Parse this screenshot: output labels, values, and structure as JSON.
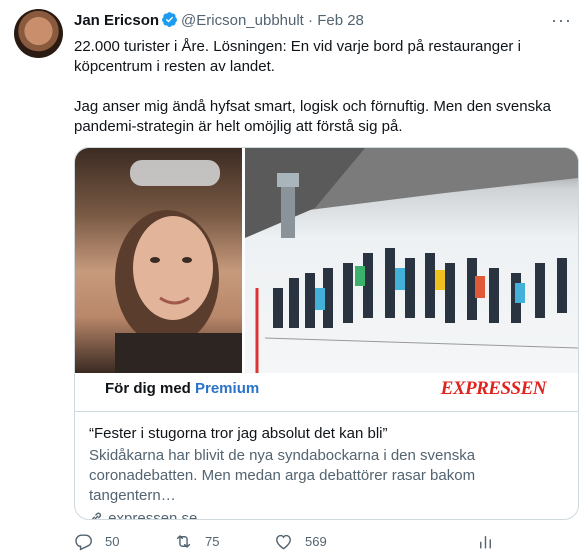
{
  "tweet": {
    "author_name": "Jan Ericson",
    "handle": "@Ericson_ubbhult",
    "separator": "·",
    "date": "Feb 28",
    "paragraphs": [
      "22.000 turister i Åre. Lösningen: En vid varje bord på restauranger i köpcentrum i resten av landet.",
      "Jag anser mig ändå hyfsat smart, logisk och förnuftig. Men den svenska pandemi-strategin är helt omöjlig att förstå sig på."
    ]
  },
  "link_card": {
    "banner_text_prefix": "För dig med ",
    "banner_text_highlight": "Premium",
    "brand": "EXPRESSEN",
    "title": "“Fester i stugorna tror jag absolut det kan bli”",
    "description": "Skidåkarna har blivit de nya syndabockarna i den svenska coronadebatten. Men medan arga debattörer rasar bakom tangentern…",
    "domain": "expressen.se"
  },
  "actions": {
    "replies": "50",
    "retweets": "75",
    "likes": "569"
  },
  "icons": [
    "verified-badge-icon",
    "more-icon",
    "link-icon",
    "reply-icon",
    "retweet-icon",
    "like-icon",
    "analytics-icon"
  ],
  "colors": {
    "verified": "#1d9bf0",
    "secondary_text": "#536471",
    "premium_blue": "#2a73c9",
    "brand_red": "#e0231e"
  }
}
